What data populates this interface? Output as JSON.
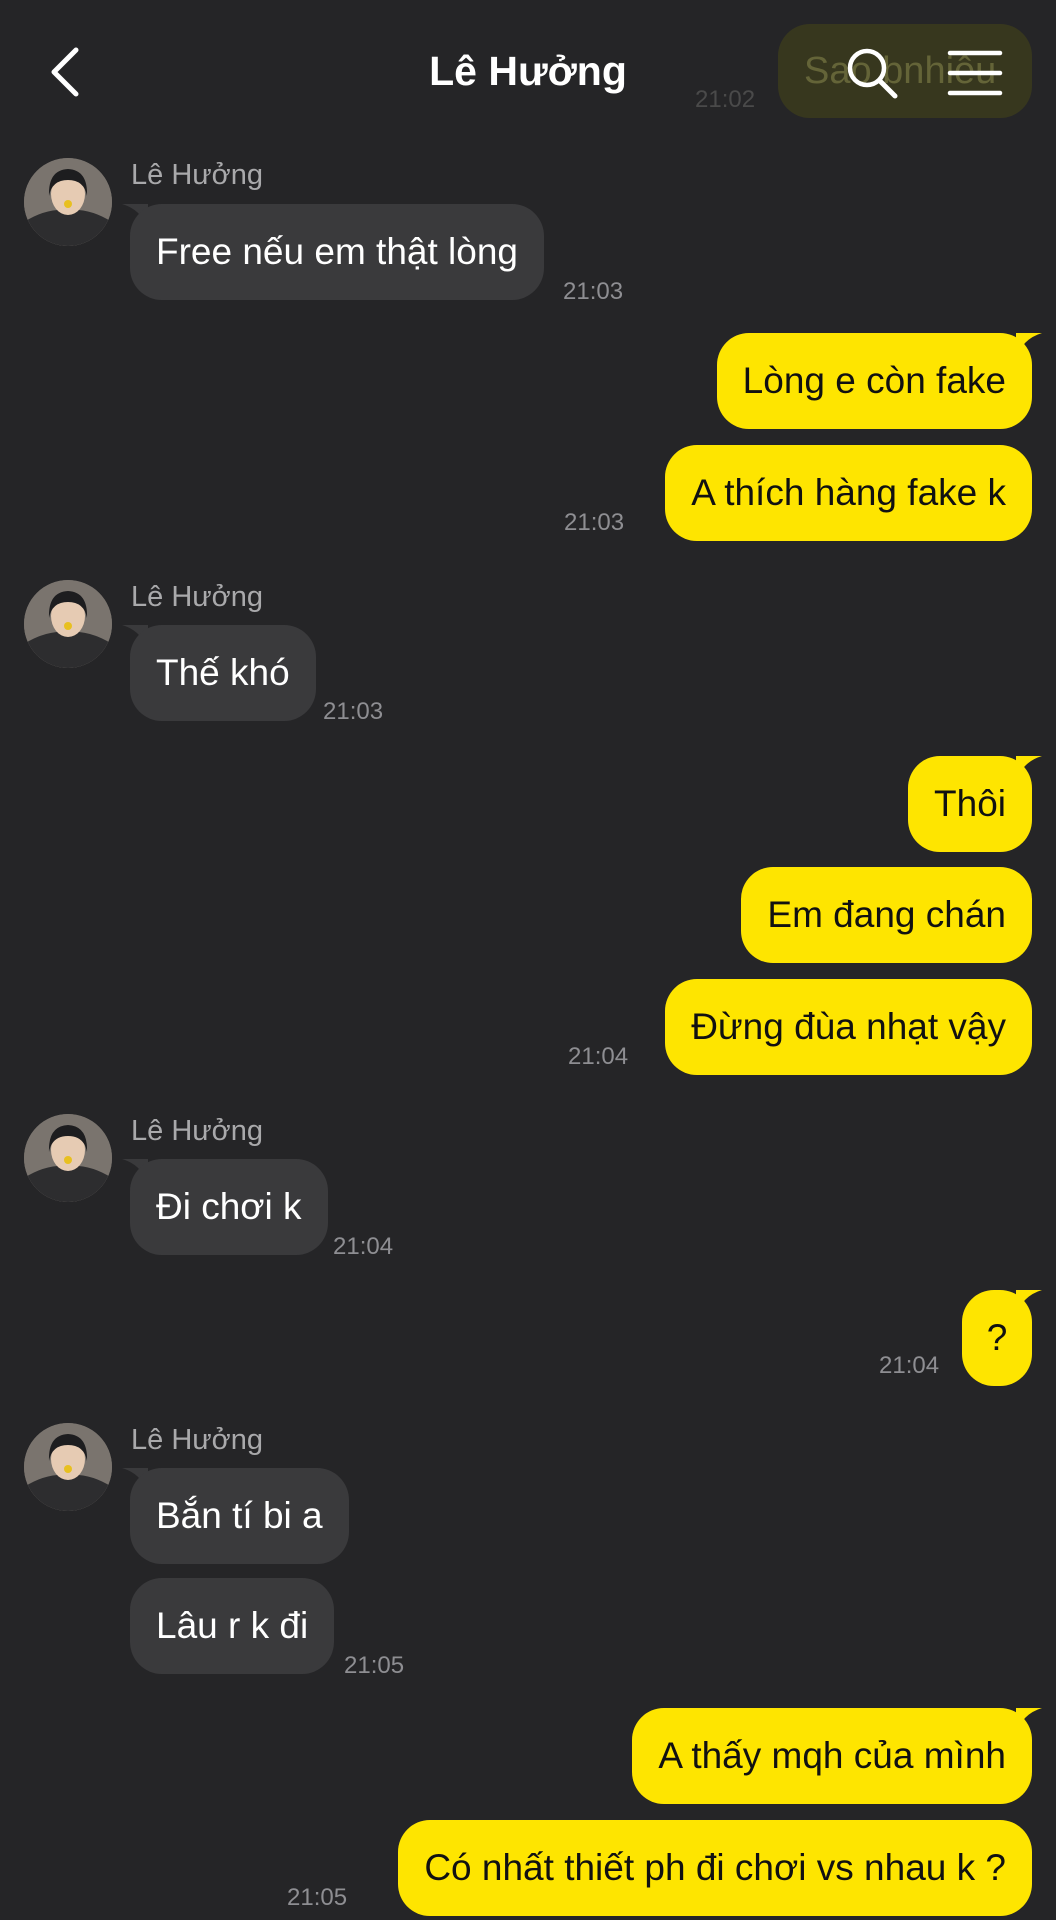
{
  "header": {
    "title": "Lê Hưởng",
    "ghost_message": "Sao bnhiêu",
    "ghost_time": "21:02"
  },
  "colors": {
    "background": "#252527",
    "incoming_bubble": "#3a3a3c",
    "outgoing_bubble": "#fee500",
    "timestamp": "#8e8e92"
  },
  "messages": [
    {
      "from": "them",
      "sender": "Lê Hưởng",
      "text": "Free nếu em thật lòng",
      "time": "21:03"
    },
    {
      "from": "me",
      "text": "Lòng e còn fake"
    },
    {
      "from": "me",
      "text": "A thích hàng fake k",
      "time": "21:03"
    },
    {
      "from": "them",
      "sender": "Lê Hưởng",
      "text": "Thế khó",
      "time": "21:03"
    },
    {
      "from": "me",
      "text": "Thôi"
    },
    {
      "from": "me",
      "text": "Em đang chán"
    },
    {
      "from": "me",
      "text": "Đừng đùa nhạt vậy",
      "time": "21:04"
    },
    {
      "from": "them",
      "sender": "Lê Hưởng",
      "text": "Đi chơi k",
      "time": "21:04"
    },
    {
      "from": "me",
      "text": "?",
      "time": "21:04"
    },
    {
      "from": "them",
      "sender": "Lê Hưởng",
      "text": "Bắn tí bi a"
    },
    {
      "from": "them",
      "text": "Lâu r k đi",
      "time": "21:05"
    },
    {
      "from": "me",
      "text": "A thấy mqh của mình"
    },
    {
      "from": "me",
      "text": "Có nhất thiết ph đi chơi vs nhau k ?",
      "time": "21:05"
    }
  ]
}
